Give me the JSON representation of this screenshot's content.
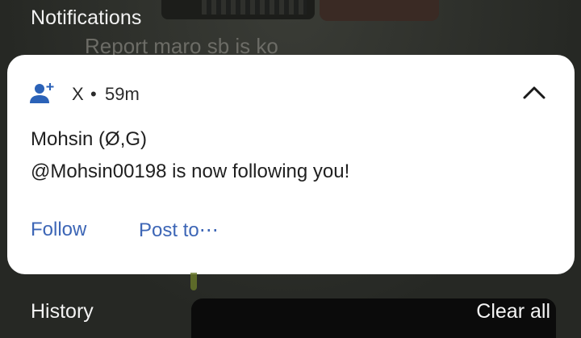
{
  "shade": {
    "notifications_label": "Notifications",
    "background_peek_text": "Report maro sb is ko",
    "history_label": "History",
    "clear_all_label": "Clear all"
  },
  "notification": {
    "app_icon": "person-add-icon",
    "app_name": "X",
    "separator": "•",
    "time_ago": "59m",
    "collapse_icon": "chevron-up-icon",
    "title": "Mohsin (Ø,G)",
    "message": "@Mohsin00198 is now following you!",
    "actions": [
      {
        "label": "Follow"
      },
      {
        "label": "Post to⋯"
      }
    ],
    "accent_color": "#3d66b6",
    "icon_color": "#2b62b8"
  }
}
